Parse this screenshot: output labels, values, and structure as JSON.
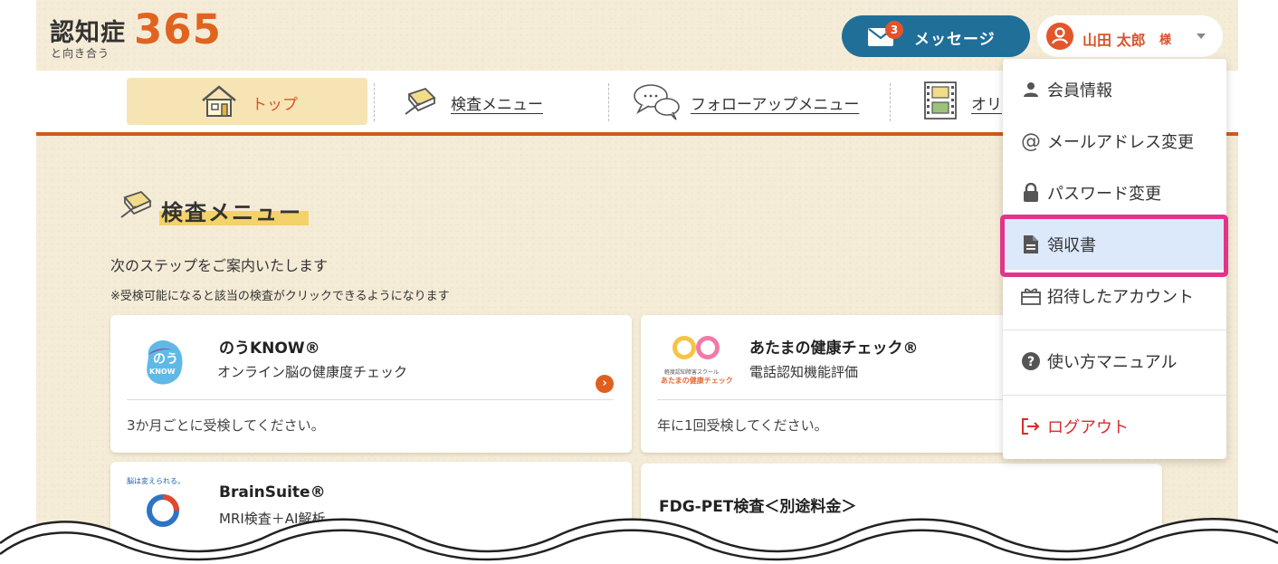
{
  "header": {
    "logo_main": "認知症",
    "logo_sub": "と向き合う",
    "logo_number": "365",
    "messages_label": "メッセージ",
    "messages_count": "3",
    "user_name": "山田 太郎",
    "user_suffix": "様"
  },
  "nav": {
    "items": [
      {
        "label": "トップ",
        "active": true
      },
      {
        "label": "検査メニュー"
      },
      {
        "label": "フォローアップメニュー"
      },
      {
        "label": "オリ"
      }
    ]
  },
  "section": {
    "title": "検査メニュー",
    "desc1": "次のステップをご案内いたします",
    "desc2": "※受検可能になると該当の検査がクリックできるようになります"
  },
  "cards": [
    {
      "title": "のうKNOW®",
      "subtitle": "オンライン脳の健康度チェック",
      "footer": "3か月ごとに受検してください。",
      "logo_text": "のう",
      "logo_sub": "KNOW"
    },
    {
      "title": "あたまの健康チェック®",
      "subtitle": "電話認知機能評価",
      "footer": "年に1回受検してください。",
      "logo_caption1": "軽度認知障害スクール",
      "logo_caption2": "あたまの健康チェック"
    },
    {
      "title": "BrainSuite®",
      "subtitle": "MRI検査＋AI解析",
      "logo_caption": "脳は変えられる。"
    },
    {
      "title": "FDG-PET検査＜別途料金＞"
    }
  ],
  "dropdown": {
    "items": [
      {
        "label": "会員情報",
        "icon": "person-icon"
      },
      {
        "label": "メールアドレス変更",
        "icon": "at-icon"
      },
      {
        "label": "パスワード変更",
        "icon": "lock-icon"
      },
      {
        "label": "領収書",
        "icon": "document-icon",
        "highlighted": true
      },
      {
        "label": "招待したアカウント",
        "icon": "gift-icon"
      },
      {
        "label": "使い方マニュアル",
        "icon": "help-icon"
      },
      {
        "label": "ログアウト",
        "icon": "logout-icon"
      }
    ]
  },
  "colors": {
    "accent": "#e06420",
    "nav_border": "#cf5b1e",
    "message_button": "#1f6f98",
    "highlight_frame": "#e2348a",
    "highlight_bg": "#dce9fb",
    "logout": "#d92d2d"
  }
}
